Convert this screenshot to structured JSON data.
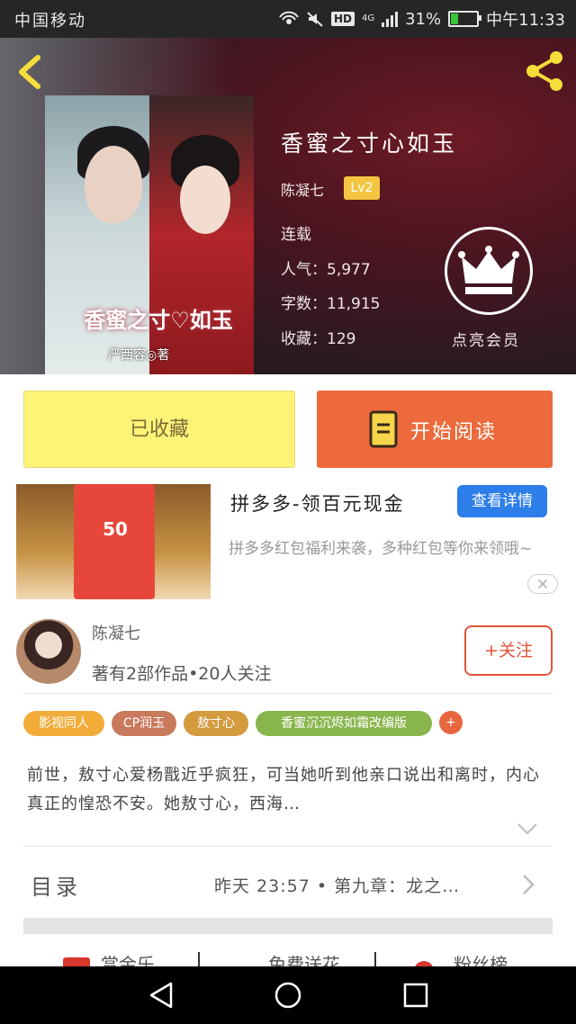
{
  "status_bar": {
    "carrier": "中国移动",
    "network": "4G",
    "hd": "HD",
    "battery": "31%",
    "battery_level": 0.31,
    "time": "中午11:33"
  },
  "book": {
    "title": "香蜜之寸心如玉",
    "author": "陈凝七",
    "author_level": "Lv2",
    "status": "连载",
    "popularity": "人气：5,977",
    "word_count": "字数：11,915",
    "favorites": "收藏：129",
    "cover_title": "香蜜之寸♡如玉",
    "cover_author": "严西容◎著"
  },
  "vip": {
    "label": "点亮会员"
  },
  "actions": {
    "collected_label": "已收藏",
    "read_label": "开始阅读"
  },
  "ad": {
    "title": "拼多多-领百元现金",
    "detail_button": "查看详情",
    "description": "拼多多红包福利来袭，多种红包等你来领哦~",
    "image_amount": "50"
  },
  "author_info": {
    "name": "陈凝七",
    "stats": "著有2部作品•20人关注",
    "follow_label": "+关注"
  },
  "tags": [
    {
      "label": "影视同人",
      "color": "#f2ac3a"
    },
    {
      "label": "CP润玉",
      "color": "#c9795c"
    },
    {
      "label": "敖寸心",
      "color": "#d39b3e"
    },
    {
      "label": "香蜜沉沉烬如霜改编版",
      "color": "#88b54c"
    }
  ],
  "tag_more": "+",
  "description": "前世，敖寸心爱杨戬近乎疯狂，可当她听到他亲口说出和离时，内心真正的惶恐不安。她敖寸心，西海…",
  "catalog": {
    "label": "目录",
    "latest": "昨天 23:57 • 第九章：龙之…"
  },
  "bottom_peek": [
    "赏金乐",
    "免费送花",
    "粉丝榜"
  ],
  "colors": {
    "accent_orange": "#ec6a3c",
    "collected_yellow": "#fdf377",
    "detail_blue": "#2d7ee8",
    "level_badge": "#f4c542"
  }
}
